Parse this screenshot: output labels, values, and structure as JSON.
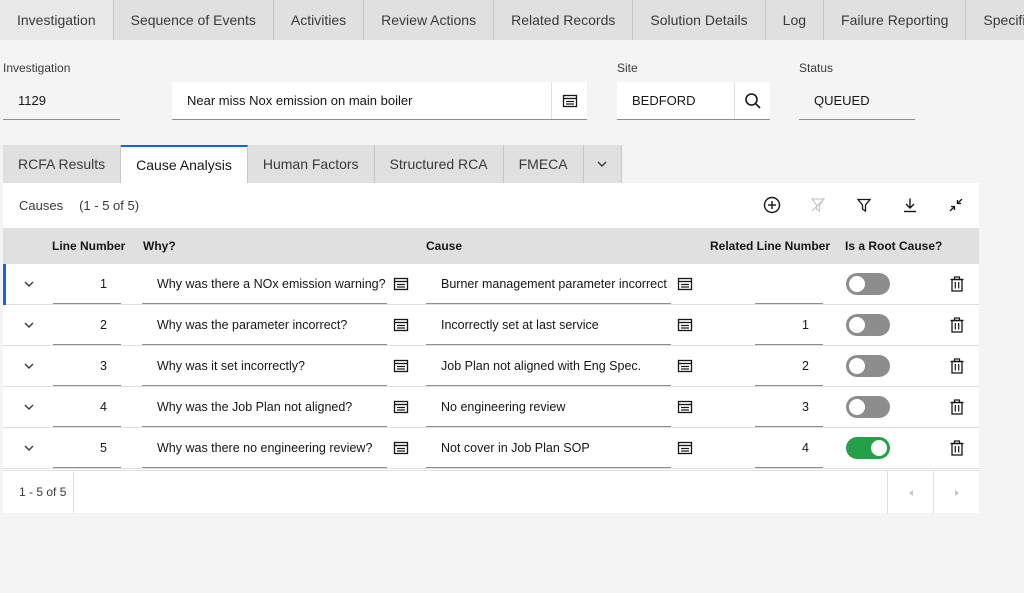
{
  "top_tabs": [
    "Investigation",
    "Sequence of Events",
    "Activities",
    "Review Actions",
    "Related Records",
    "Solution Details",
    "Log",
    "Failure Reporting",
    "Specifications"
  ],
  "header": {
    "investigation_label": "Investigation",
    "investigation_value": "1129",
    "description_value": "Near miss Nox emission on main boiler",
    "site_label": "Site",
    "site_value": "BEDFORD",
    "status_label": "Status",
    "status_value": "QUEUED"
  },
  "sub_tabs": [
    "RCFA Results",
    "Cause Analysis",
    "Human Factors",
    "Structured RCA",
    "FMECA"
  ],
  "active_sub_tab": "Cause Analysis",
  "table": {
    "title": "Causes",
    "count": "(1 - 5 of 5)",
    "columns": {
      "line_number": "Line Number",
      "why": "Why?",
      "cause": "Cause",
      "related_line": "Related Line Number",
      "root_cause": "Is a Root Cause?"
    },
    "rows": [
      {
        "line": "1",
        "why": "Why was there a NOx emission warning?",
        "cause": "Burner management parameter incorrect",
        "related": "",
        "root": false
      },
      {
        "line": "2",
        "why": "Why was the parameter incorrect?",
        "cause": "Incorrectly set at last service",
        "related": "1",
        "root": false
      },
      {
        "line": "3",
        "why": "Why was it set incorrectly?",
        "cause": "Job Plan not aligned with Eng Spec.",
        "related": "2",
        "root": false
      },
      {
        "line": "4",
        "why": "Why was the Job Plan not aligned?",
        "cause": "No engineering review",
        "related": "3",
        "root": false
      },
      {
        "line": "5",
        "why": "Why was there no engineering review?",
        "cause": "Not cover in Job Plan SOP",
        "related": "4",
        "root": true
      }
    ],
    "pager_info": "1 - 5 of 5"
  },
  "icons": {
    "add": "add-icon",
    "clear_filter": "clear-filter-icon",
    "filter": "filter-icon",
    "download": "download-icon",
    "collapse": "minimize-icon",
    "lookup": "lookup-icon",
    "search": "search-icon",
    "trash": "trash-icon",
    "chevron": "chevron-down-icon"
  },
  "colors": {
    "accent": "#0f62fe",
    "toggle_on": "#24a148",
    "toggle_off": "#8d8d8d"
  }
}
